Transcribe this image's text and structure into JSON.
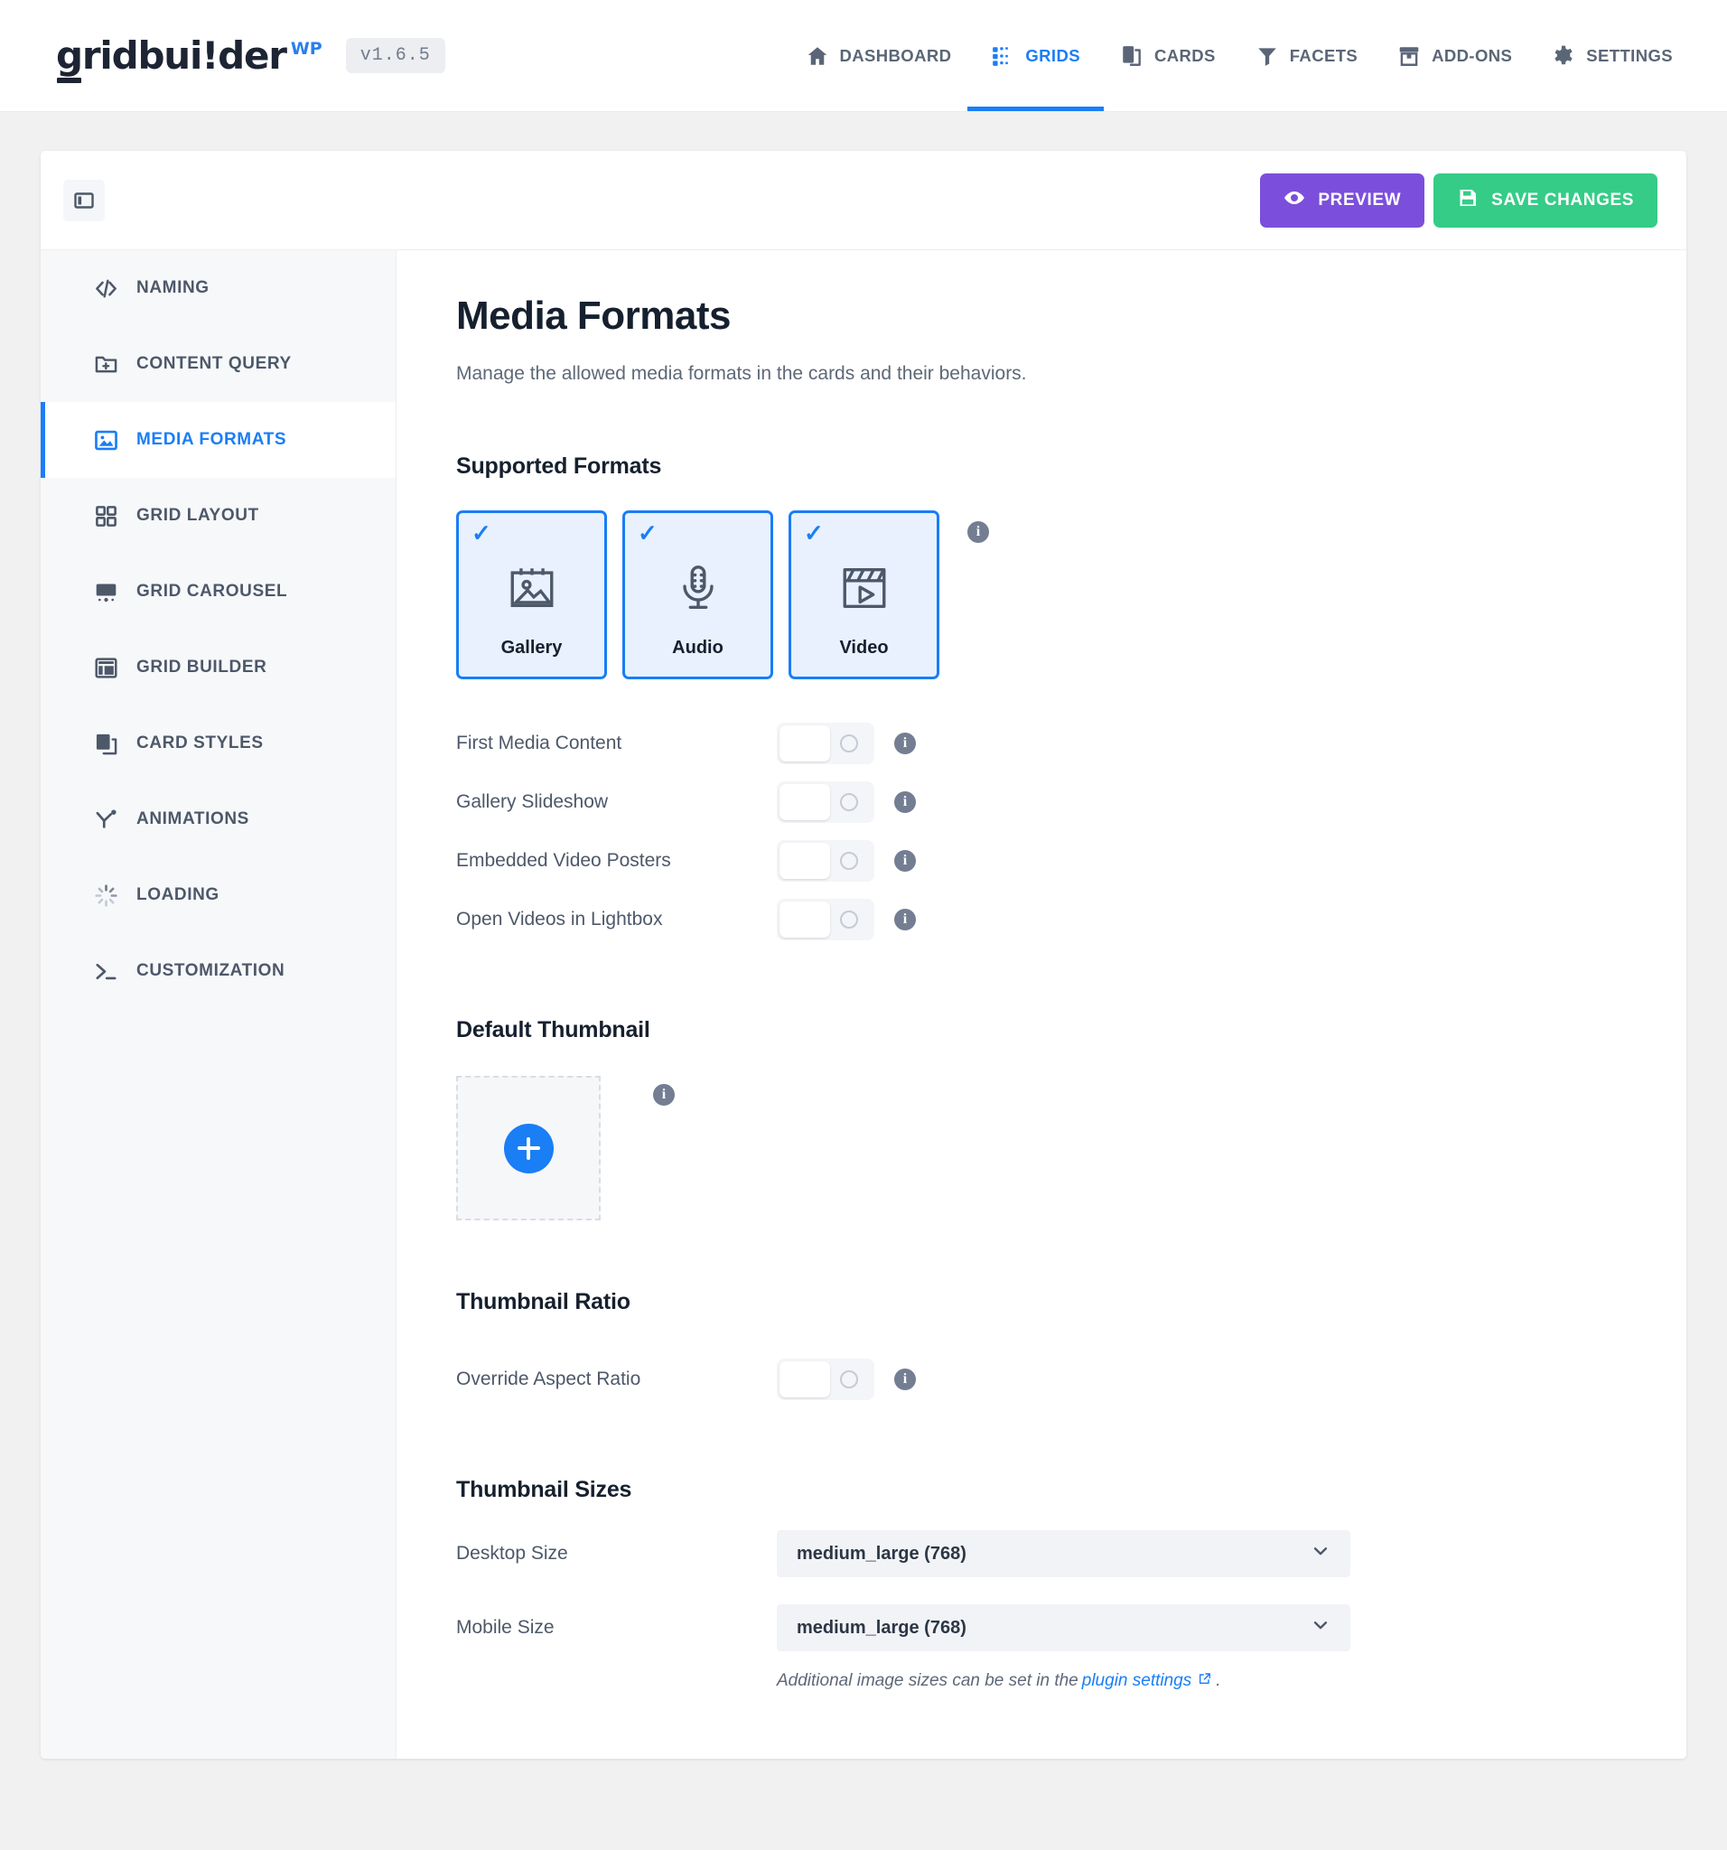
{
  "brand": {
    "name": "gridbui!der",
    "suffix": "WP",
    "version": "v1.6.5"
  },
  "topnav": [
    {
      "label": "DASHBOARD",
      "icon": "home-icon",
      "active": false
    },
    {
      "label": "GRIDS",
      "icon": "grids-icon",
      "active": true
    },
    {
      "label": "CARDS",
      "icon": "cards-icon",
      "active": false
    },
    {
      "label": "FACETS",
      "icon": "facets-icon",
      "active": false
    },
    {
      "label": "ADD-ONS",
      "icon": "addons-icon",
      "active": false
    },
    {
      "label": "SETTINGS",
      "icon": "gear-icon",
      "active": false
    }
  ],
  "header": {
    "panel_toggle_icon": "panel-collapse-icon",
    "preview_label": "PREVIEW",
    "preview_icon": "eye-icon",
    "save_label": "SAVE CHANGES",
    "save_icon": "floppy-disk-icon"
  },
  "sidebar": {
    "items": [
      {
        "label": "NAMING",
        "icon": "code-icon",
        "active": false
      },
      {
        "label": "CONTENT QUERY",
        "icon": "folder-plus-icon",
        "active": false
      },
      {
        "label": "MEDIA FORMATS",
        "icon": "image-icon",
        "active": true
      },
      {
        "label": "GRID LAYOUT",
        "icon": "grid-squares-icon",
        "active": false
      },
      {
        "label": "GRID CAROUSEL",
        "icon": "carousel-icon",
        "active": false
      },
      {
        "label": "GRID BUILDER",
        "icon": "layout-builder-icon",
        "active": false
      },
      {
        "label": "CARD STYLES",
        "icon": "cards-stack-icon",
        "active": false
      },
      {
        "label": "ANIMATIONS",
        "icon": "animation-icon",
        "active": false
      },
      {
        "label": "LOADING",
        "icon": "spinner-icon",
        "active": false
      },
      {
        "label": "CUSTOMIZATION",
        "icon": "terminal-icon",
        "active": false
      }
    ]
  },
  "main": {
    "title": "Media Formats",
    "description": "Manage the allowed media formats in the cards and their behaviors.",
    "supported_formats": {
      "heading": "Supported Formats",
      "cards": [
        {
          "label": "Gallery",
          "icon": "gallery-image-icon",
          "checked": true
        },
        {
          "label": "Audio",
          "icon": "microphone-icon",
          "checked": true
        },
        {
          "label": "Video",
          "icon": "clapperboard-icon",
          "checked": true
        }
      ],
      "toggles": [
        {
          "label": "First Media Content",
          "on": false
        },
        {
          "label": "Gallery Slideshow",
          "on": false
        },
        {
          "label": "Embedded Video Posters",
          "on": false
        },
        {
          "label": "Open Videos in Lightbox",
          "on": false
        }
      ]
    },
    "default_thumbnail": {
      "heading": "Default Thumbnail",
      "add_icon": "plus-icon"
    },
    "thumbnail_ratio": {
      "heading": "Thumbnail Ratio",
      "toggles": [
        {
          "label": "Override Aspect Ratio",
          "on": false
        }
      ]
    },
    "thumbnail_sizes": {
      "heading": "Thumbnail Sizes",
      "desktop_label": "Desktop Size",
      "desktop_value": "medium_large (768)",
      "mobile_label": "Mobile Size",
      "mobile_value": "medium_large (768)",
      "hint_before": "Additional image sizes can be set in the",
      "hint_link": "plugin settings",
      "hint_after": "."
    }
  },
  "colors": {
    "accent": "#1a7ef5",
    "preview": "#7b4fdb",
    "save": "#35cc87",
    "page_bg": "#f1f1f1",
    "sidebar_bg": "#f7f8fa"
  }
}
